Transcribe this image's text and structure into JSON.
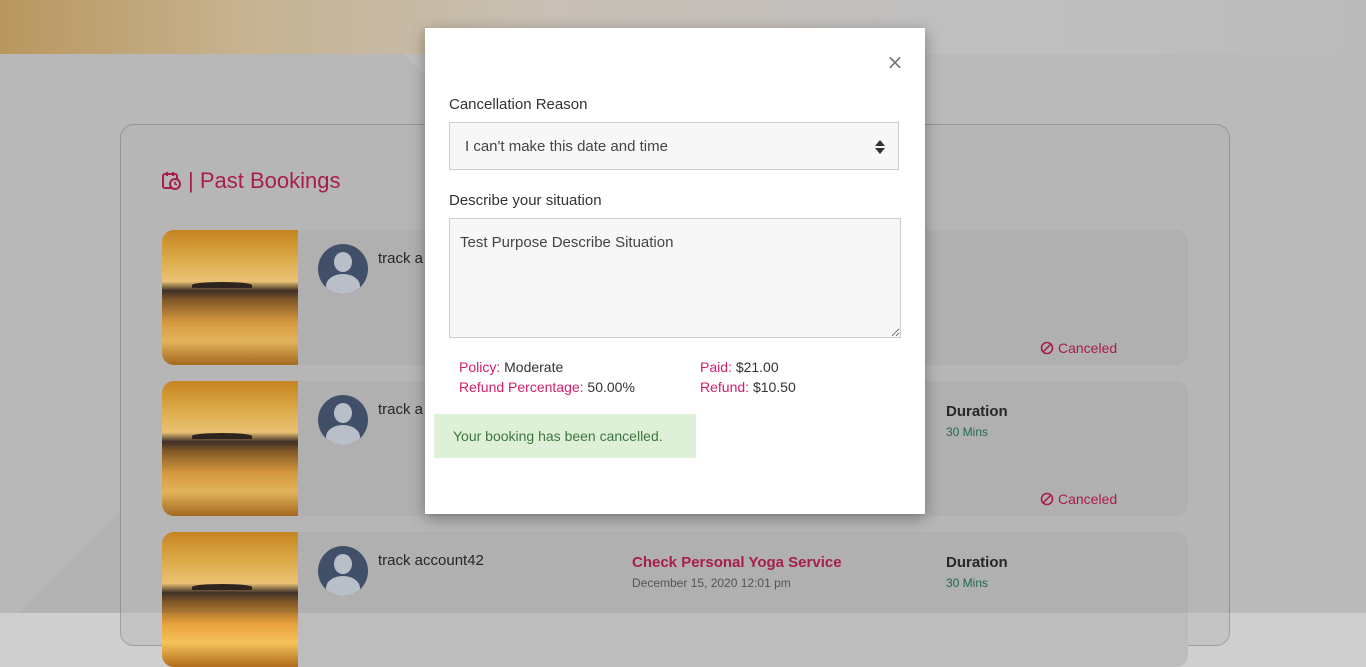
{
  "page": {
    "section_title": "| Past Bookings",
    "bookings": [
      {
        "account": "track a",
        "status": "Canceled"
      },
      {
        "account": "track a",
        "duration_label": "Duration",
        "duration_value": "30 Mins",
        "status": "Canceled"
      },
      {
        "account": "track account42",
        "service": "Check Personal Yoga Service",
        "date": "December 15, 2020 12:01 pm",
        "duration_label": "Duration",
        "duration_value": "30 Mins"
      }
    ]
  },
  "modal": {
    "close_label": "×",
    "reason_label": "Cancellation Reason",
    "reason_value": "I can't make this date and time",
    "situation_label": "Describe your situation",
    "situation_value": "Test Purpose Describe Situation",
    "policy_key": "Policy:",
    "policy_value": "Moderate",
    "refund_pct_key": "Refund Percentage:",
    "refund_pct_value": "50.00%",
    "paid_key": "Paid:",
    "paid_value": "$21.00",
    "refund_key": "Refund:",
    "refund_value": "$10.50",
    "alert_text": "Your booking has been cancelled."
  },
  "icons": {
    "calendar": "calendar-clock-icon",
    "cancel": "ban-icon",
    "close": "close-icon",
    "avatar": "user-avatar-icon",
    "select": "select-arrows-icon"
  },
  "colors": {
    "accent": "#b4164f",
    "accent_label": "#d0206a",
    "success_bg": "#dff0d8",
    "success_text": "#3c763d",
    "duration": "#1a6b52"
  }
}
